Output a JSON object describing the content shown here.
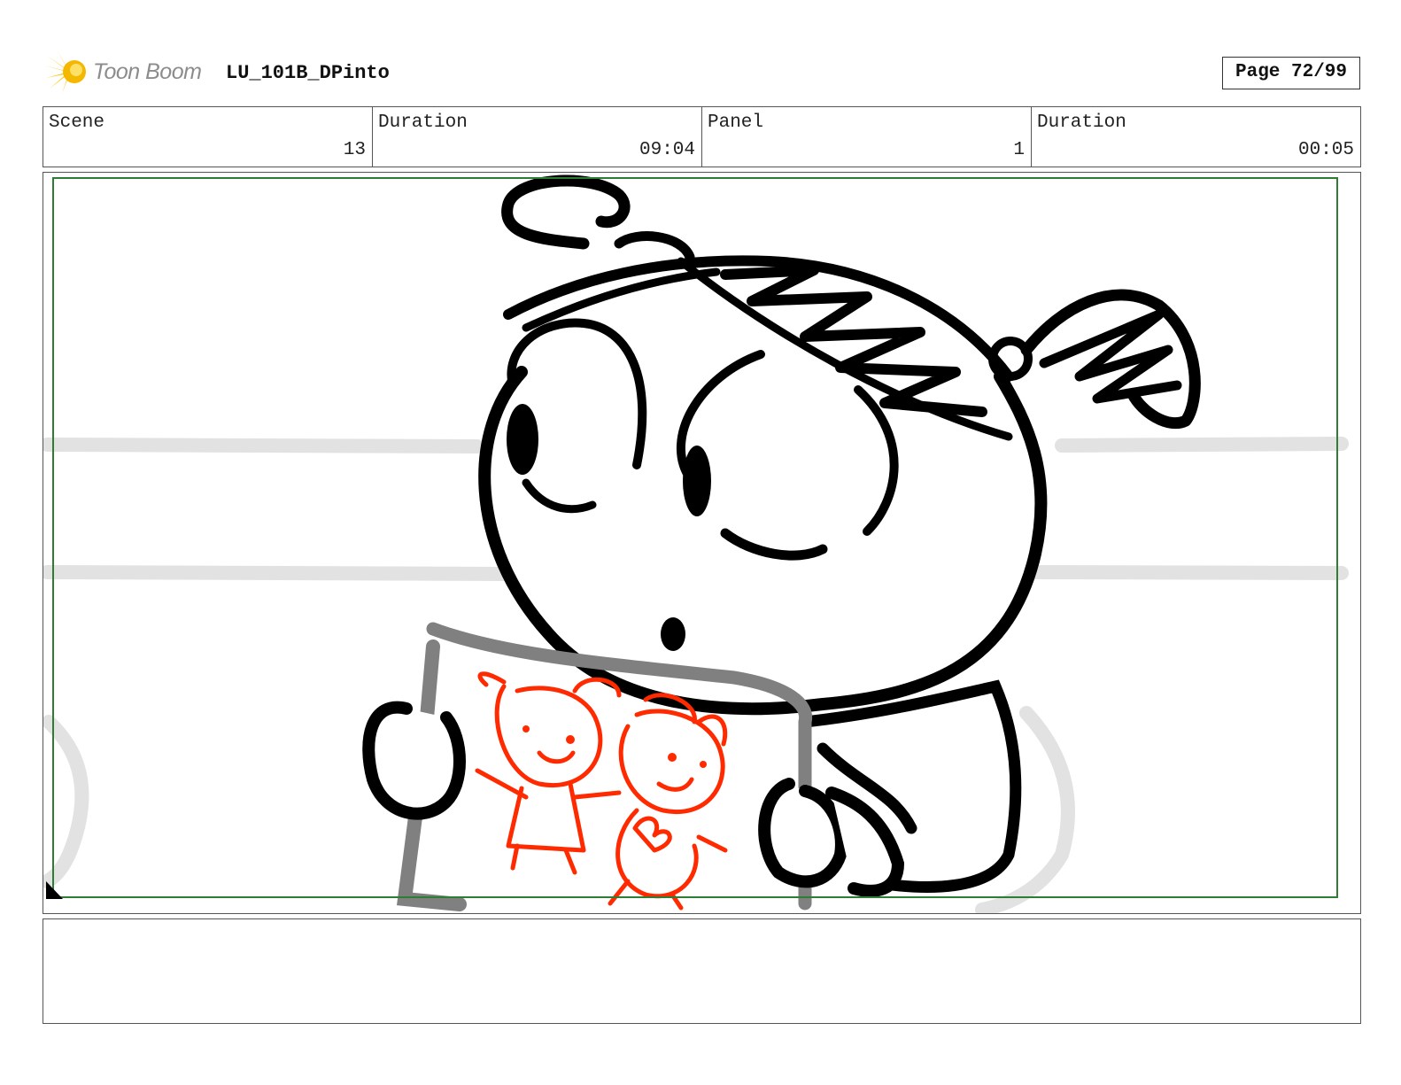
{
  "header": {
    "logo_text": "Toon Boom",
    "project_name": "LU_101B_DPinto",
    "page_label": "Page 72/99"
  },
  "info": {
    "scene_label": "Scene",
    "scene_value": "13",
    "scene_duration_label": "Duration",
    "scene_duration_value": "09:04",
    "panel_label": "Panel",
    "panel_value": "1",
    "panel_duration_label": "Duration",
    "panel_duration_value": "00:05"
  },
  "panel": {
    "frame_color": "#2e7d32",
    "line_color": "#000000",
    "drawing_color": "#ff2a00",
    "background_line_color": "#e2e2e2",
    "paper_edge_color": "#808080"
  },
  "notes": {
    "text": ""
  }
}
